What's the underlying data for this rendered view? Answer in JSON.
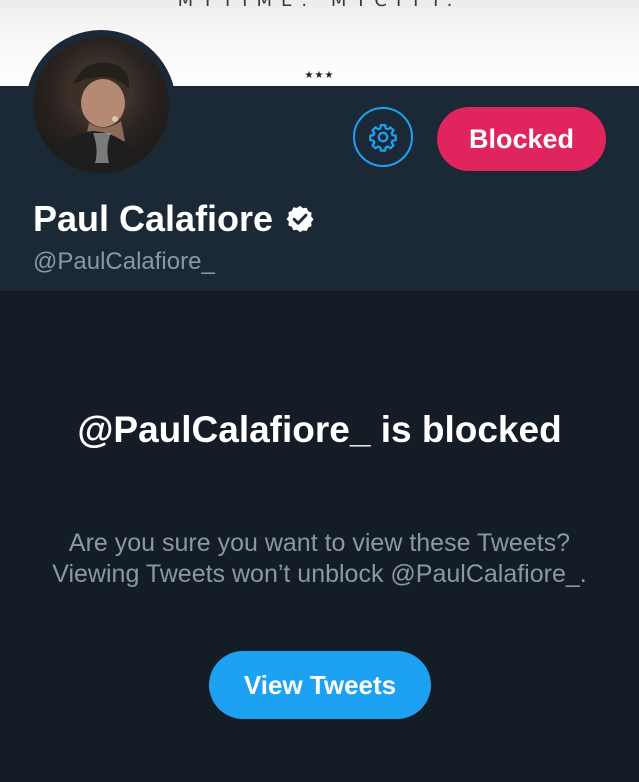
{
  "banner": {
    "text": "MYTIME. MYCITY.",
    "stars": "★★★"
  },
  "profile": {
    "name": "Paul Calafiore",
    "handle": "@PaulCalafiore_",
    "verified": true,
    "avatar_icon": "avatar-photo",
    "settings_icon": "gear-icon",
    "blocked_label": "Blocked"
  },
  "blocked_notice": {
    "title": "@PaulCalafiore_ is blocked",
    "body": "Are you sure you want to view these Tweets? Viewing Tweets won’t unblock @PaulCalafiore_.",
    "view_button_label": "View Tweets"
  },
  "colors": {
    "background": "#141d26",
    "header": "#1b2836",
    "accent_blue": "#1da1f2",
    "blocked_red": "#e0245e",
    "secondary_text": "#8899a6"
  }
}
